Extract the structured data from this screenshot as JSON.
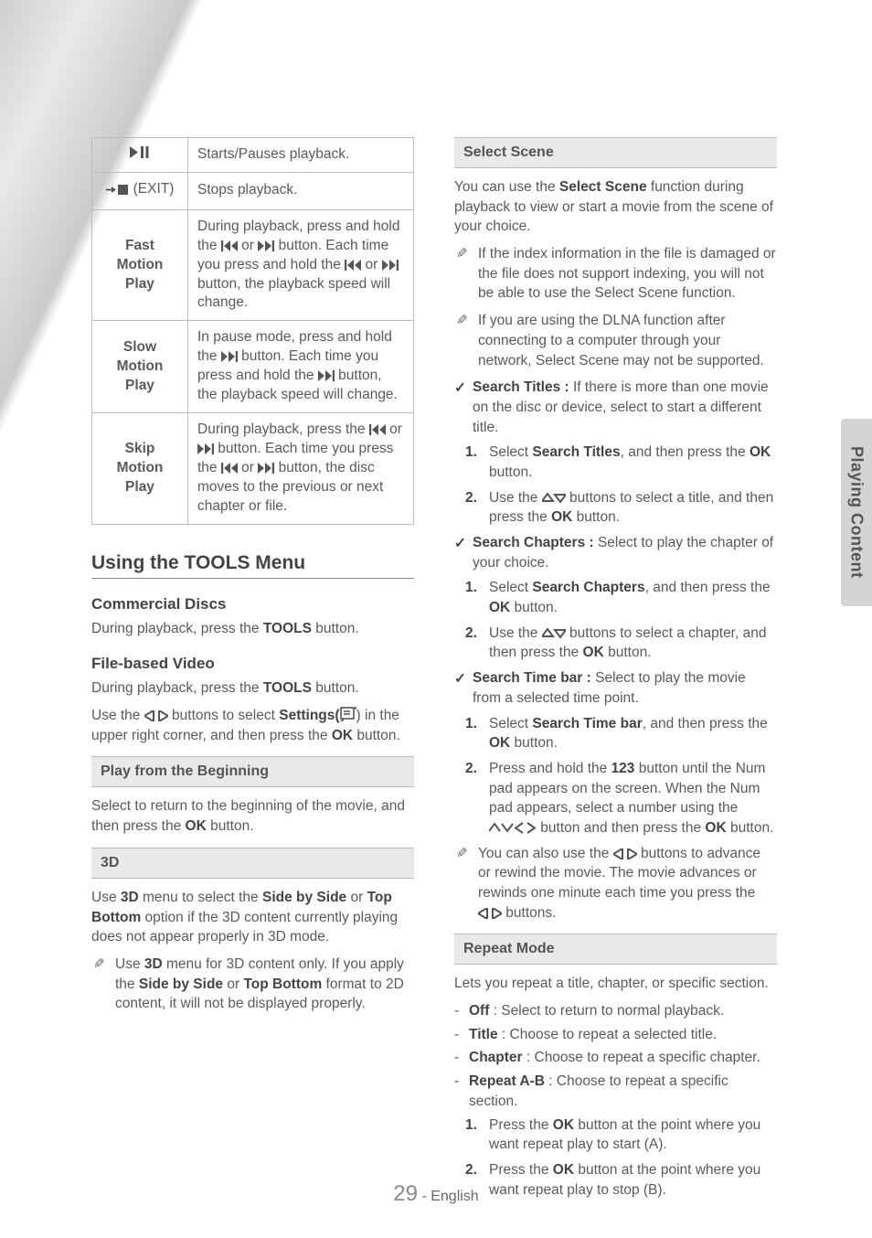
{
  "side_tab": "Playing Content",
  "table": {
    "rows": [
      {
        "label_icon": "play-pause",
        "label_text": "",
        "desc_parts": [
          "Starts/Pauses playback."
        ]
      },
      {
        "label_icon": "stop-exit",
        "label_text": "(EXIT)",
        "desc_parts": [
          "Stops playback."
        ]
      },
      {
        "label_icon": "",
        "label_text": "Fast Motion Play",
        "desc_parts": [
          "During playback, press and hold the ",
          "@PREV@",
          " or ",
          "@NEXT@",
          " button. Each time you press and hold the ",
          "@PREV@",
          " or ",
          "@NEXT@",
          " button, the playback speed will change."
        ]
      },
      {
        "label_icon": "",
        "label_text": "Slow Motion Play",
        "desc_parts": [
          "In pause mode, press and hold the ",
          "@NEXT@",
          " button. Each time you press and hold the ",
          "@NEXT@",
          " button, the playback speed will change."
        ]
      },
      {
        "label_icon": "",
        "label_text": "Skip Motion Play",
        "desc_parts": [
          "During playback, press the ",
          "@PREV@",
          " or ",
          "@NEXT@",
          " button. Each time you press the ",
          "@PREV@",
          " or ",
          "@NEXT@",
          " button, the disc moves to the previous or next chapter or file."
        ]
      }
    ]
  },
  "tools_heading": "Using the TOOLS Menu",
  "commercial": {
    "heading": "Commercial Discs",
    "text_parts": [
      "During playback, press the ",
      "TOOLS",
      " button."
    ]
  },
  "filebased": {
    "heading": "File-based Video",
    "p1_parts": [
      "During playback, press the ",
      "TOOLS",
      " button."
    ],
    "p2_parts": [
      "Use the ",
      "@LR@",
      " buttons to select ",
      "Settings(",
      "@SETTINGS@",
      ")",
      " in the upper right corner, and then press the ",
      "OK",
      " button."
    ]
  },
  "play_beginning": {
    "box": "Play from the Beginning",
    "text_parts": [
      "Select to return to the beginning of the movie, and then press the ",
      "OK",
      " button."
    ]
  },
  "threeD": {
    "box": "3D",
    "text_parts": [
      "Use ",
      "3D",
      " menu to select the ",
      "Side by Side",
      " or ",
      "Top Bottom",
      " option if the 3D content currently playing does not appear properly in 3D mode."
    ],
    "note_parts": [
      "Use ",
      "3D",
      " menu for 3D content only. If you apply the ",
      "Side by Side",
      " or ",
      "Top Bottom",
      " format to 2D content, it will not be displayed properly."
    ]
  },
  "select_scene": {
    "box": "Select Scene",
    "intro_parts": [
      "You can use the ",
      "Select Scene",
      " function during playback to view or start a movie from the scene of your choice."
    ],
    "notes": [
      [
        "If the index information in the file is damaged or the file does not support indexing, you will not be able to use the Select Scene function."
      ],
      [
        "If you are using the DLNA function after connecting to a computer through your network, Select Scene may not be supported."
      ]
    ],
    "search_titles": {
      "lead_parts": [
        "Search Titles : ",
        "If there is more than one movie on the disc or device, select to start a different title."
      ],
      "steps": [
        [
          "Select ",
          "Search Titles",
          ", and then press the ",
          "OK",
          " button."
        ],
        [
          "Use the ",
          "@UD@",
          " buttons to select a title, and then press the ",
          "OK",
          " button."
        ]
      ]
    },
    "search_chapters": {
      "lead_parts": [
        "Search Chapters : ",
        "Select to play the chapter of your choice."
      ],
      "steps": [
        [
          "Select ",
          "Search Chapters",
          ", and then press the ",
          "OK",
          " button."
        ],
        [
          "Use the ",
          "@UD@",
          " buttons to select a chapter, and then press the ",
          "OK",
          " button."
        ]
      ]
    },
    "search_time": {
      "lead_parts": [
        "Search Time bar : ",
        "Select to play the movie from a selected time point."
      ],
      "steps": [
        [
          "Select ",
          "Search Time bar",
          ", and then press the ",
          "OK",
          " button."
        ],
        [
          "Press and hold the ",
          "123",
          " button until the Num pad appears on the screen. When the Num pad appears, select a number using the ",
          "@UDLR@",
          " button and then press the ",
          "OK",
          " button."
        ]
      ],
      "note_parts": [
        "You can also use the ",
        "@LR@",
        " buttons to advance or rewind the movie. The movie advances or rewinds one minute each time you press the ",
        "@LR@",
        " buttons."
      ]
    }
  },
  "repeat": {
    "box": "Repeat Mode",
    "intro": "Lets you repeat a title, chapter, or specific section.",
    "items": [
      [
        "Off",
        " : Select to return to normal playback."
      ],
      [
        "Title",
        " : Choose to repeat a selected title."
      ],
      [
        "Chapter",
        " : Choose to repeat a specific chapter."
      ],
      [
        "Repeat A-B",
        " : Choose to repeat a specific section."
      ]
    ],
    "steps": [
      [
        "Press the ",
        "OK",
        " button at the point where you want repeat play to start (A)."
      ],
      [
        "Press the ",
        "OK",
        " button at the point where you want repeat play to stop (B)."
      ]
    ]
  },
  "footer": {
    "page": "29",
    "lang": "English"
  }
}
